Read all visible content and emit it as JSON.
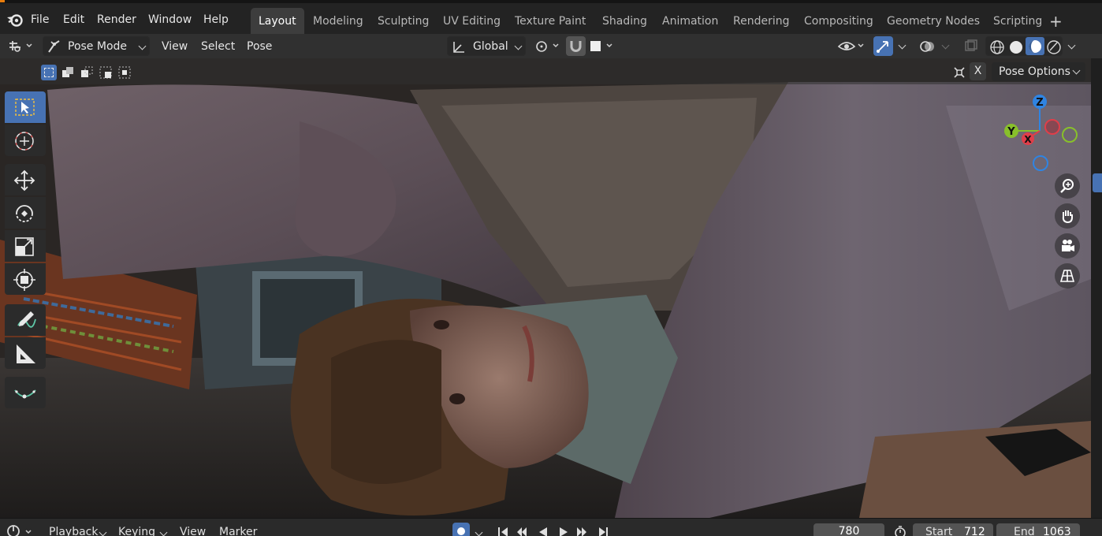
{
  "menu": {
    "items": [
      "File",
      "Edit",
      "Render",
      "Window",
      "Help"
    ]
  },
  "workspaces": {
    "tabs": [
      "Layout",
      "Modeling",
      "Sculpting",
      "UV Editing",
      "Texture Paint",
      "Shading",
      "Animation",
      "Rendering",
      "Compositing",
      "Geometry Nodes",
      "Scripting"
    ],
    "active": "Layout",
    "add_label": "+"
  },
  "header": {
    "mode": "Pose Mode",
    "menus": [
      "View",
      "Select",
      "Pose"
    ],
    "orientation": "Global"
  },
  "tool_settings": {
    "mirror_label": "X",
    "pose_options": "Pose Options"
  },
  "gizmo": {
    "z": "Z",
    "y": "Y",
    "x": "X"
  },
  "timeline": {
    "playback": "Playback",
    "keying": "Keying",
    "view": "View",
    "marker": "Marker",
    "current_frame": "780",
    "start_label": "Start",
    "start_value": "712",
    "end_label": "End",
    "end_value": "1063"
  },
  "colors": {
    "accent": "#4772b3",
    "axis_x": "#e03e49",
    "axis_y": "#88c02b",
    "axis_z": "#2f84e2"
  }
}
